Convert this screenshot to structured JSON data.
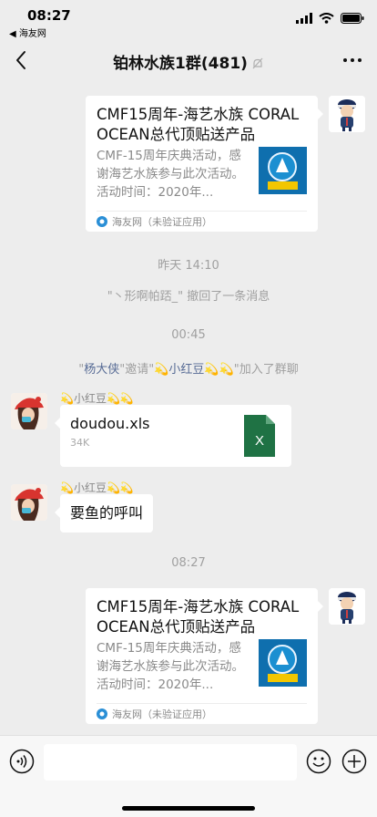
{
  "status_bar": {
    "time": "08:27",
    "back_app": "◀ 海友网",
    "icons": [
      "signal-icon",
      "wifi-icon",
      "battery-icon"
    ]
  },
  "nav": {
    "title": "铂林水族1群(481)",
    "back_icon": "chevron-left-icon",
    "mute_icon": "bell-muted-icon",
    "more_icon": "more-dots-icon"
  },
  "messages": {
    "card1": {
      "title": "CMF15周年-海艺水族 CORAL OCEAN总代顶贴送产品",
      "desc": "CMF-15周年庆典活动，感谢海艺水族参与此次活动。活动时间：2020年...",
      "source": "海友网（未验证应用）"
    },
    "time1": "昨天 14:10",
    "recall": "\"丶形啊帕踎_\" 撤回了一条消息",
    "time2": "00:45",
    "invite": {
      "quote_open": "\"",
      "inviter": "杨大侠",
      "middle": "\"邀请\"",
      "invitee_icon_left": "💫",
      "invitee": "小红豆",
      "invitee_icon_right": "💫💫",
      "suffix": "\"加入了群聊"
    },
    "sender_nick": "💫小红豆💫💫",
    "file": {
      "name": "doudou.xls",
      "size": "34K",
      "icon_letter": "X"
    },
    "sender_nick2": "💫小红豆💫💫",
    "text_msg": "要鱼的呼叫",
    "time3": "08:27",
    "card2": {
      "title": "CMF15周年-海艺水族 CORAL OCEAN总代顶贴送产品",
      "desc": "CMF-15周年庆典活动，感谢海艺水族参与此次活动。活动时间：2020年...",
      "source": "海友网（未验证应用）"
    }
  },
  "input_bar": {
    "voice_icon": "voice-icon",
    "emoji_icon": "emoji-icon",
    "plus_icon": "plus-icon"
  },
  "colors": {
    "background": "#ededed",
    "link_name": "#576b95",
    "excel_green": "#1f7244",
    "thumb_blue": "#0f6fae"
  }
}
